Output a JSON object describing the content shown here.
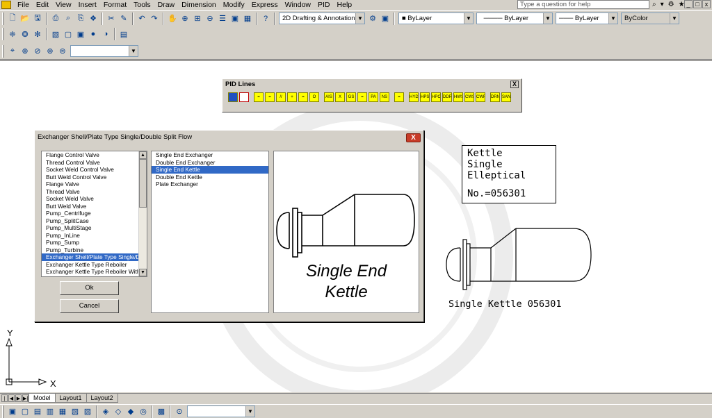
{
  "menu": [
    "File",
    "Edit",
    "View",
    "Insert",
    "Format",
    "Tools",
    "Draw",
    "Dimension",
    "Modify",
    "Express",
    "Window",
    "PID",
    "Help"
  ],
  "help_placeholder": "Type a question for help",
  "toolbar": {
    "workspace": "2D Drafting & Annotation",
    "layer": "ByLayer",
    "linetype": "ByLayer",
    "lineweight": "ByLayer",
    "color": "ByColor"
  },
  "pid_toolbar": {
    "title": "PID Lines",
    "close_label": "X",
    "buttons": [
      "",
      "",
      "=",
      "=",
      "//",
      "+",
      "=",
      "O",
      "AIS",
      "X",
      "GS",
      "=",
      "PA",
      "NS",
      "=",
      "HYD",
      "HPS",
      "HPC",
      "DDR",
      "HWS",
      "CWS",
      "CWR",
      "DRN",
      "SAN"
    ]
  },
  "dialog": {
    "title": "Exchanger Shell/Plate Type Single/Double Split Flow",
    "close_label": "X",
    "list1": [
      "Flange Control Valve",
      "Thread Control Valve",
      "Socket Weld Control Valve",
      "Butt Weld Control Valve",
      "Flange Valve",
      "Thread Valve",
      "Socket Weld Valve",
      "Butt Weld Valve",
      "Pump_Centrifuge",
      "Pump_SplitCase",
      "Pump_MultiStage",
      "Pump_InLine",
      "Pump_Sump",
      "Pump_Turbine",
      "Exchanger Shell/Plate Type Single/Doul",
      "Exchanger Kettle Type Reboiler",
      "Exchanger Kettle Type Reboiler With Sl"
    ],
    "list1_selected": 14,
    "list2": [
      "Single End Exchanger",
      "Double End Exchanger",
      "Single End Kettle",
      "Double End Kettle",
      "Plate Exchanger"
    ],
    "list2_selected": 2,
    "preview_line1": "Single End",
    "preview_line2": "Kettle",
    "ok_label": "Ok",
    "cancel_label": "Cancel"
  },
  "drawing": {
    "box_lines": [
      "Kettle",
      "Single",
      "Elleptical"
    ],
    "box_number": "No.=056301",
    "kettle_label": "Single Kettle 056301",
    "ucs_x": "X",
    "ucs_y": "Y"
  },
  "tabs": [
    "Model",
    "Layout1",
    "Layout2"
  ],
  "active_tab": 0
}
